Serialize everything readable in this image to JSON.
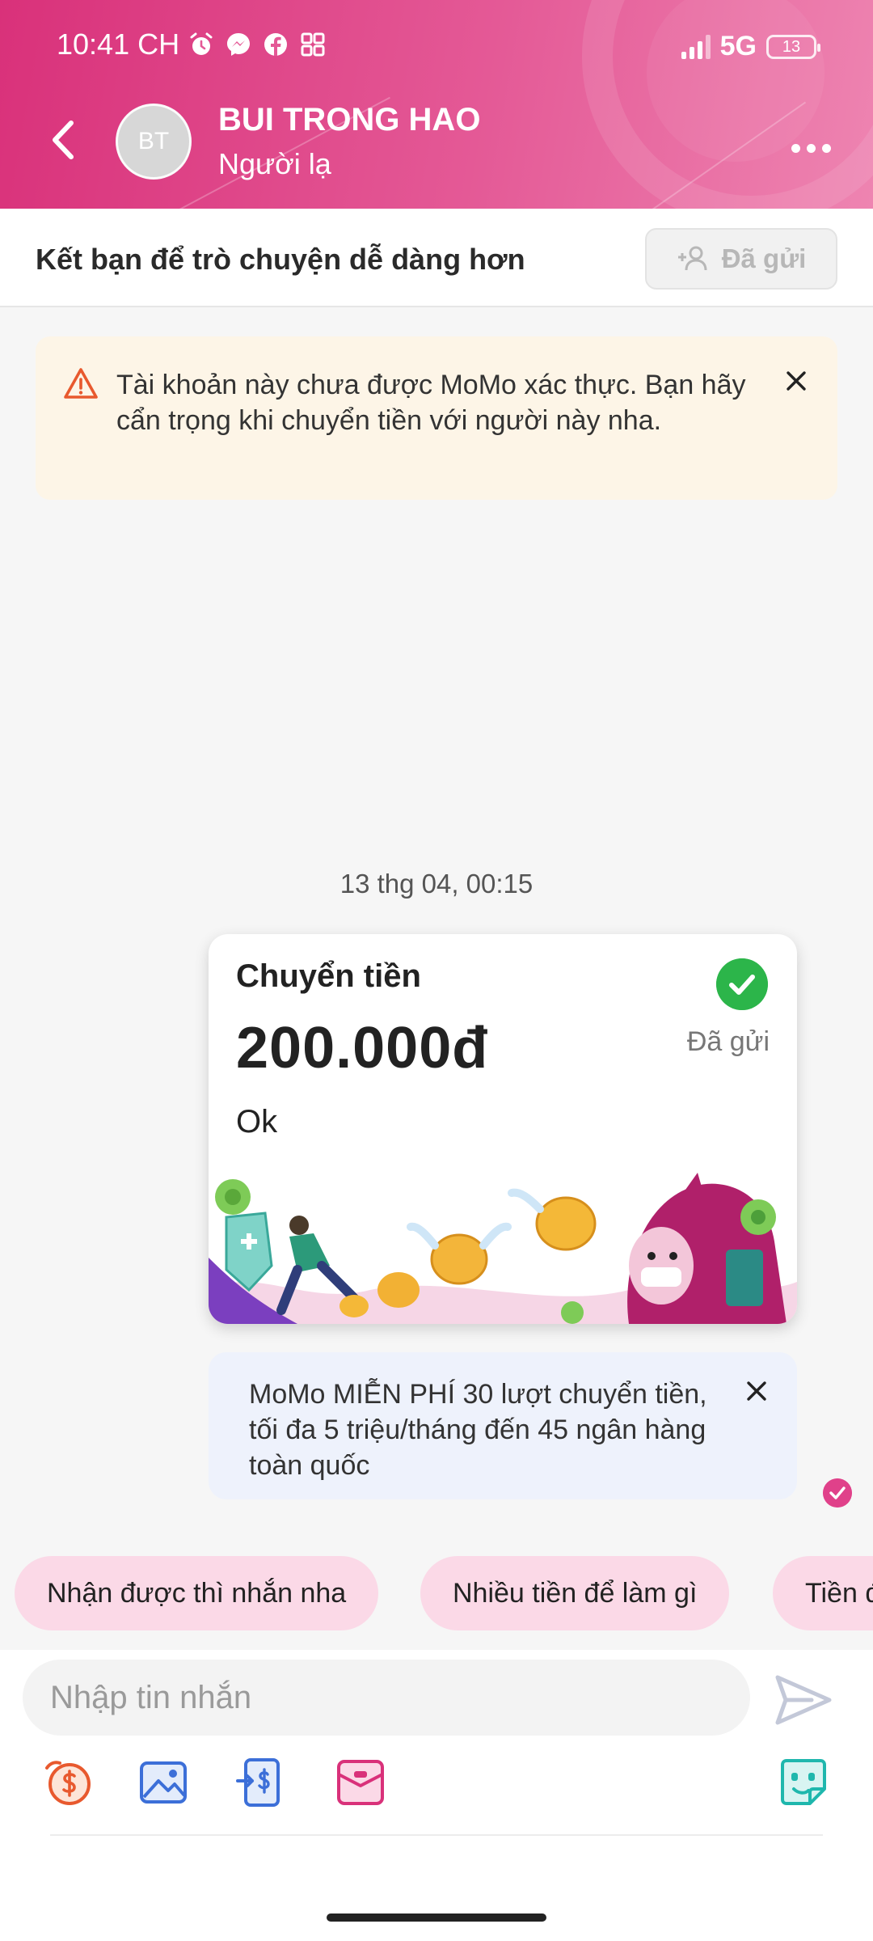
{
  "status_bar": {
    "time": "10:41 CH",
    "network": "5G",
    "battery": "13",
    "icons": [
      "alarm-icon",
      "messenger-icon",
      "facebook-icon",
      "apps-grid-icon"
    ]
  },
  "header": {
    "avatar_initials": "BT",
    "name": "BUI TRONG HAO",
    "subtitle": "Người lạ"
  },
  "friend_bar": {
    "text": "Kết bạn để trò chuyện dễ dàng hơn",
    "button_label": "Đã gửi"
  },
  "warning": {
    "text": "Tài khoản này chưa được MoMo xác thực. Bạn hãy cẩn trọng khi chuyển tiền với người này nha."
  },
  "timestamp": "13 thg 04, 00:15",
  "transfer_card": {
    "title": "Chuyển tiền",
    "amount": "200.000đ",
    "status": "Đã gửi",
    "message": "Ok"
  },
  "promo": {
    "text": "MoMo MIỄN PHÍ 30 lượt chuyển tiền, tối đa 5 triệu/tháng đến 45 ngân hàng toàn quốc"
  },
  "suggestions": [
    "Nhận được thì nhắn nha",
    "Nhiều tiền để làm gì",
    "Tiền đ"
  ],
  "composer": {
    "placeholder": "Nhập tin nhắn"
  },
  "colors": {
    "brand_pink": "#d9317a",
    "chip_bg": "#fbd9e7",
    "success_green": "#2cb54a",
    "warning_bg": "#fdf5e7"
  }
}
